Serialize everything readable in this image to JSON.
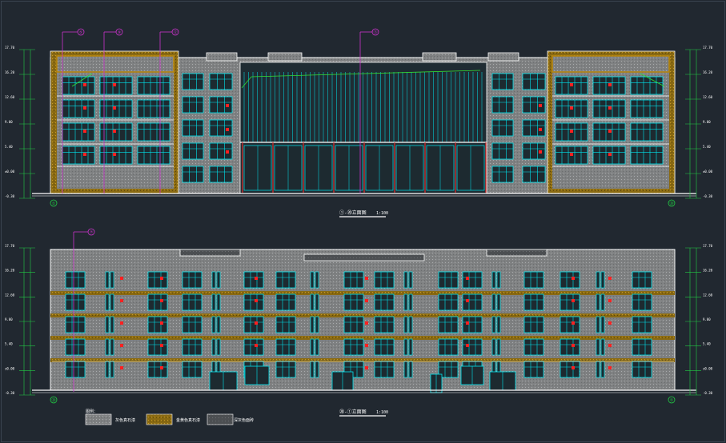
{
  "colors": {
    "background": "#212830",
    "wall": "#8f8f8f",
    "outline": "#ffffff",
    "glass": "#00e5ee",
    "frame": "#b8860b",
    "axis": "#cc33cc",
    "dim": "#22cc44",
    "mark": "#ff2020",
    "roof_line": "#33dd33"
  },
  "drawing": {
    "elevation_top": {
      "title": "①-⑳立面图",
      "scale": "1:100",
      "grid_left": "①",
      "grid_right": "⑳",
      "axis_tags": [
        "⑤",
        "⑨",
        "⑫",
        "⑬"
      ],
      "levels": [
        "17.70",
        "16.20",
        "12.60",
        "9.00",
        "5.40",
        "±0.00",
        "-0.30"
      ]
    },
    "elevation_bottom": {
      "title": "⑳-①立面图",
      "scale": "1:100",
      "grid_left": "⑳",
      "grid_right": "①",
      "axis_tags": [
        "⑦"
      ],
      "levels": [
        "17.70",
        "16.20",
        "12.60",
        "9.00",
        "5.40",
        "±0.00",
        "-0.30"
      ]
    },
    "legend": {
      "title": "图例：",
      "items": [
        {
          "label": "灰色真石漆",
          "pattern": "gray"
        },
        {
          "label": "金黄色真石漆",
          "pattern": "gold"
        },
        {
          "label": "深灰色面砖",
          "pattern": "dark"
        }
      ]
    }
  }
}
